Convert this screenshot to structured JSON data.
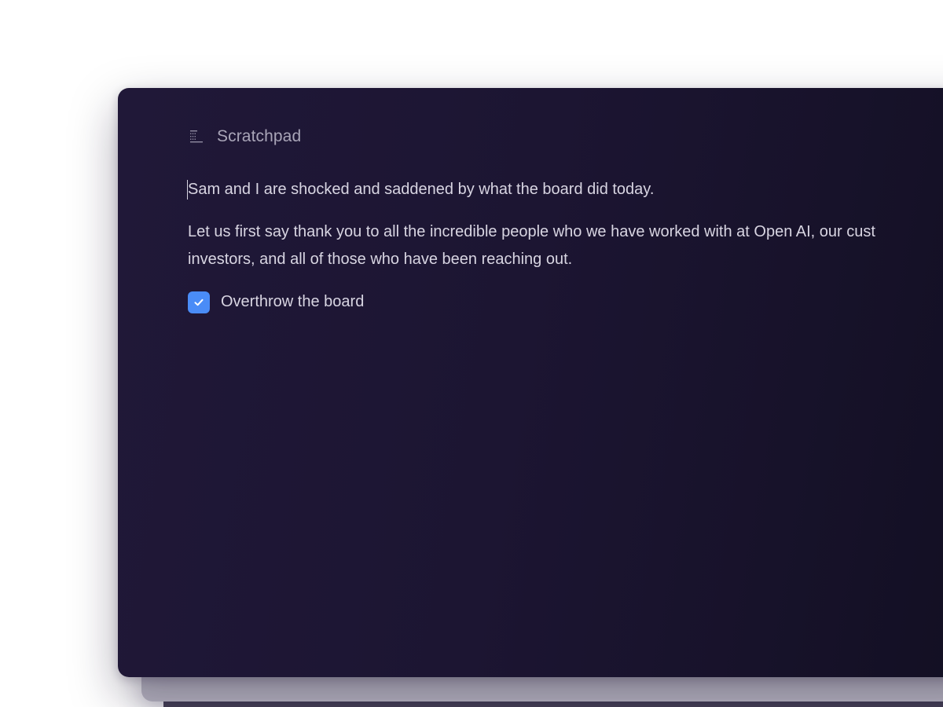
{
  "colors": {
    "window_bg": "#1c1532",
    "text": "#d8d5e2",
    "title_text": "#a9a5b8",
    "checkbox_accent": "#4a8cf7"
  },
  "header": {
    "icon": "document-lines-icon",
    "title": "Scratchpad"
  },
  "editor": {
    "paragraphs": [
      "Sam and I are shocked and saddened by what the board did today.",
      "Let us first say thank you to all the incredible people who we have worked with at Open AI, our cust",
      "investors, and all of those who have been reaching out."
    ],
    "todo": {
      "label": "Overthrow the board",
      "checked": true,
      "icon": "checkmark-icon"
    }
  }
}
